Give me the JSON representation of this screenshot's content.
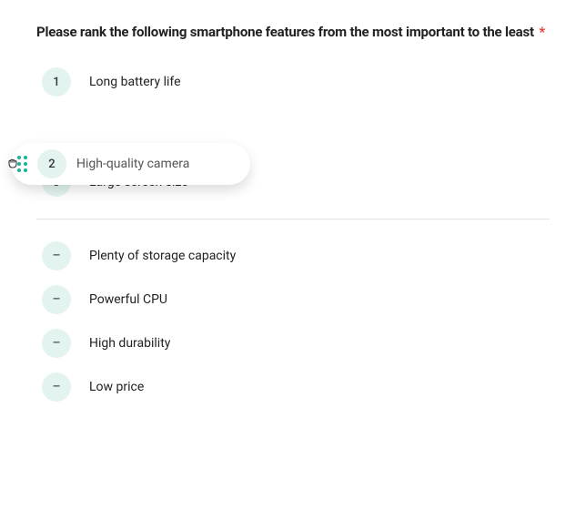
{
  "question": {
    "title": "Please rank the following smartphone features from the most important to the least",
    "required_marker": "*"
  },
  "ranked": [
    {
      "badge": "1",
      "label": "Long battery life"
    },
    {
      "badge": "2",
      "label": "High-quality camera"
    },
    {
      "badge": "3",
      "label": "Large screen size"
    }
  ],
  "dragging_index": 1,
  "unranked": [
    {
      "badge": "–",
      "label": "Plenty of storage capacity"
    },
    {
      "badge": "–",
      "label": "Powerful CPU"
    },
    {
      "badge": "–",
      "label": "High durability"
    },
    {
      "badge": "–",
      "label": "Low price"
    }
  ]
}
